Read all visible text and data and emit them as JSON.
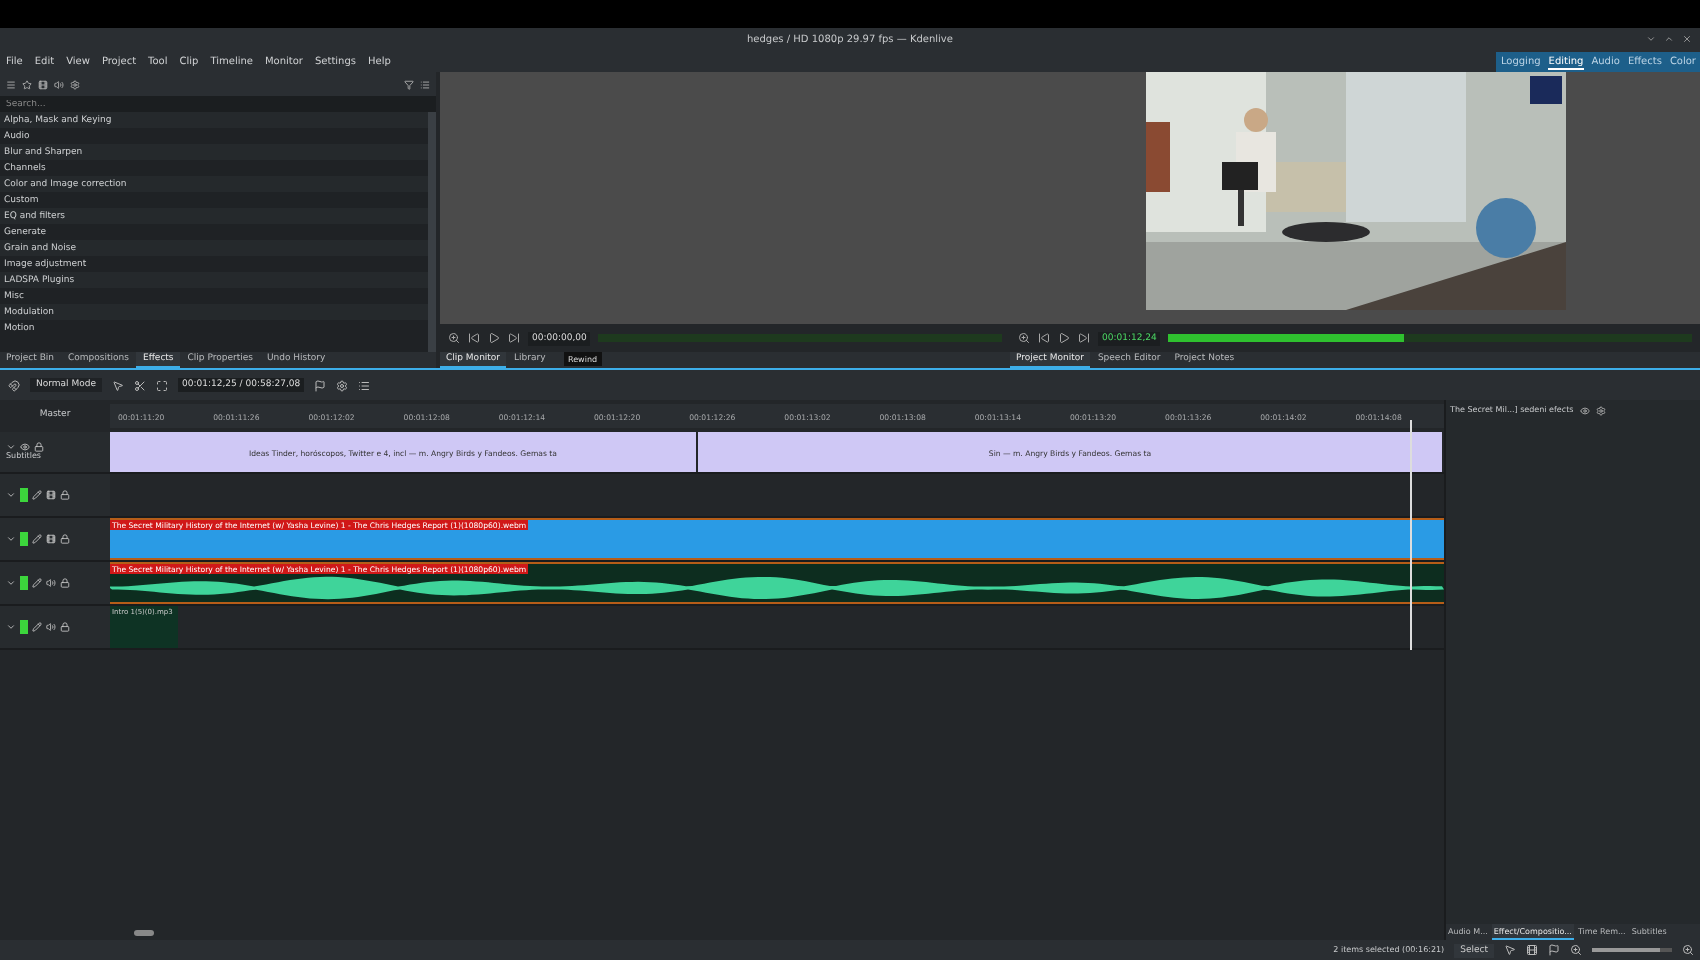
{
  "window": {
    "title": "hedges / HD 1080p 29.97 fps — Kdenlive"
  },
  "menu": [
    "File",
    "Edit",
    "View",
    "Project",
    "Tool",
    "Clip",
    "Timeline",
    "Monitor",
    "Settings",
    "Help"
  ],
  "workspaces": [
    {
      "label": "Logging",
      "selected": false
    },
    {
      "label": "Editing",
      "selected": true
    },
    {
      "label": "Audio",
      "selected": false
    },
    {
      "label": "Effects",
      "selected": false
    },
    {
      "label": "Color",
      "selected": false
    }
  ],
  "effects_panel": {
    "search": {
      "placeholder": "Search..."
    },
    "categories": [
      "Alpha, Mask and Keying",
      "Audio",
      "Blur and Sharpen",
      "Channels",
      "Color and Image correction",
      "Custom",
      "EQ and filters",
      "Generate",
      "Grain and Noise",
      "Image adjustment",
      "LADSPA Plugins",
      "Misc",
      "Modulation",
      "Motion"
    ],
    "tabs": [
      {
        "label": "Project Bin",
        "selected": false
      },
      {
        "label": "Compositions",
        "selected": false
      },
      {
        "label": "Effects",
        "selected": true
      },
      {
        "label": "Clip Properties",
        "selected": false
      },
      {
        "label": "Undo History",
        "selected": false
      }
    ]
  },
  "clip_monitor": {
    "timecode": "00:00:00,00",
    "tooltip": "Rewind",
    "tabs": [
      {
        "label": "Clip Monitor",
        "selected": true
      },
      {
        "label": "Library",
        "selected": false
      }
    ]
  },
  "project_monitor": {
    "timecode": "00:01:12,24",
    "meter": {
      "level": 0.45
    },
    "tabs": [
      {
        "label": "Project Monitor",
        "selected": true
      },
      {
        "label": "Speech Editor",
        "selected": false
      },
      {
        "label": "Project Notes",
        "selected": false
      }
    ]
  },
  "timeline": {
    "mode": "Normal Mode",
    "timecode": "00:01:12,25 / 00:58:27,08",
    "header": "Master",
    "ruler": [
      "00:01:11:20",
      "00:01:11:26",
      "00:01:12:02",
      "00:01:12:08",
      "00:01:12:14",
      "00:01:12:20",
      "00:01:12:26",
      "00:01:13:02",
      "00:01:13:08",
      "00:01:13:14",
      "00:01:13:20",
      "00:01:13:26",
      "00:01:14:02",
      "00:01:14:08"
    ],
    "tracks": [
      {
        "kind": "subtitle",
        "label": "Subtitles",
        "clips": [
          "Ideas Tinder, horóscopos, Twitter e 4, incl — m. Angry Birds y Fandeos. Gemas ta",
          "Sin — m. Angry Birds y Fandeos. Gemas ta"
        ]
      },
      {
        "kind": "video"
      },
      {
        "kind": "video",
        "clips": [
          "The Secret Military History of the Internet (w/ Yasha Levine) 1 - The Chris Hedges Report (1)(1080p60).webm"
        ]
      },
      {
        "kind": "audio",
        "clips": [
          "The Secret Military History of the Internet (w/ Yasha Levine) 1 - The Chris Hedges Report (1)(1080p60).webm"
        ]
      },
      {
        "kind": "audio",
        "clips": [
          "Intro 1(5)(0).mp3"
        ]
      }
    ]
  },
  "effect_stack": {
    "title": "The Secret Mil...] sedeni efects",
    "tabs": [
      {
        "label": "Audio M...",
        "selected": false
      },
      {
        "label": "Effect/Compositio...",
        "selected": true
      },
      {
        "label": "Time Rem...",
        "selected": false
      },
      {
        "label": "Subtitles",
        "selected": false
      }
    ]
  },
  "status_bar": {
    "text": "2 items selected (00:16:21)",
    "button": "Select",
    "zoom": {
      "level": 0.85
    }
  }
}
